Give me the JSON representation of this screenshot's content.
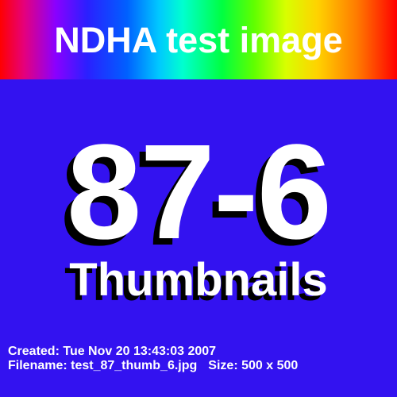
{
  "banner": {
    "title": "NDHA test image"
  },
  "main": {
    "number": "87-6",
    "subtitle": "Thumbnails"
  },
  "info": {
    "created": "Created: Tue Nov 20 13:43:03 2007",
    "filename": "Filename: test_87_thumb_6.jpg",
    "size": "Size: 500 x 500"
  },
  "colors": {
    "background": "#3312f0",
    "text": "#ffffff",
    "shadow": "#000000"
  }
}
